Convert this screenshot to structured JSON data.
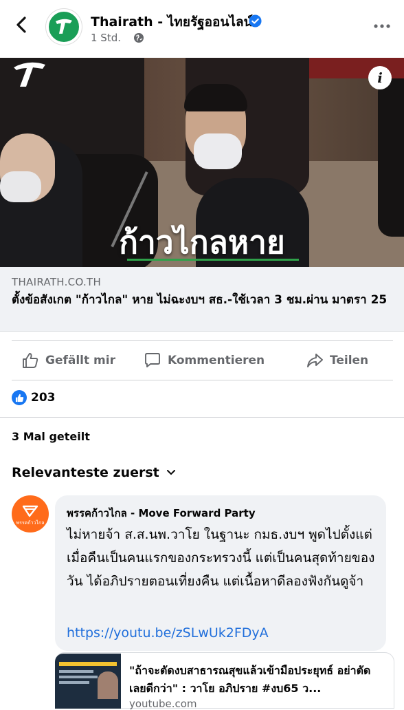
{
  "header": {
    "page_name": "Thairath - ไทยรัฐออนไลน์",
    "time": "1 Std.",
    "icons": [
      "back-arrow-icon",
      "verified-badge-icon",
      "globe-icon",
      "more-options-icon"
    ]
  },
  "post": {
    "image_headline": "ก้าวไกลหาย",
    "info_label": "i",
    "link_domain": "THAIRATH.CO.TH",
    "link_title": "ตั้งข้อสังเกต \"ก้าวไกล\" หาย ไม่ฉะงบฯ สธ.-ใช้เวลา 3 ชม.ผ่าน มาตรา 25"
  },
  "actions": {
    "like_label": "Gefällt mir",
    "comment_label": "Kommentieren",
    "share_label": "Teilen"
  },
  "stats": {
    "like_count": "203",
    "shares": "3 Mal geteilt"
  },
  "comments": {
    "sort_label": "Relevanteste zuerst",
    "items": [
      {
        "author": "พรรคก้าวไกล - Move Forward Party",
        "avatar_caption": "พรรคก้าวไกล",
        "text": "ไม่หายจ้า ส.ส.นพ.วาโย ในฐานะ กมธ.งบฯ พูดไปตั้งแต่เมื่อคืนเป็นคนแรกของกระทรวงนี้ แต่เป็นคนสุดท้ายของวัน ได้อภิปรายตอนเที่ยงคืน แต่เนื้อหาดีลองฟังกันดูจ้า",
        "link": "https://youtu.be/zSLwUk2FDyA",
        "preview_title": "\"ถ้าจะตัดงบสาธารณสุขแล้วเข้ามือประยุทธ์ อย่าตัดเลยดีกว่า\" : วาโย อภิปราย #งบ65 ว...",
        "preview_domain": "youtube.com"
      }
    ]
  },
  "colors": {
    "brand_blue": "#1877f2",
    "link_blue": "#216fdb",
    "thairath_green": "#1a9e57",
    "party_orange": "#ff6b1a"
  }
}
